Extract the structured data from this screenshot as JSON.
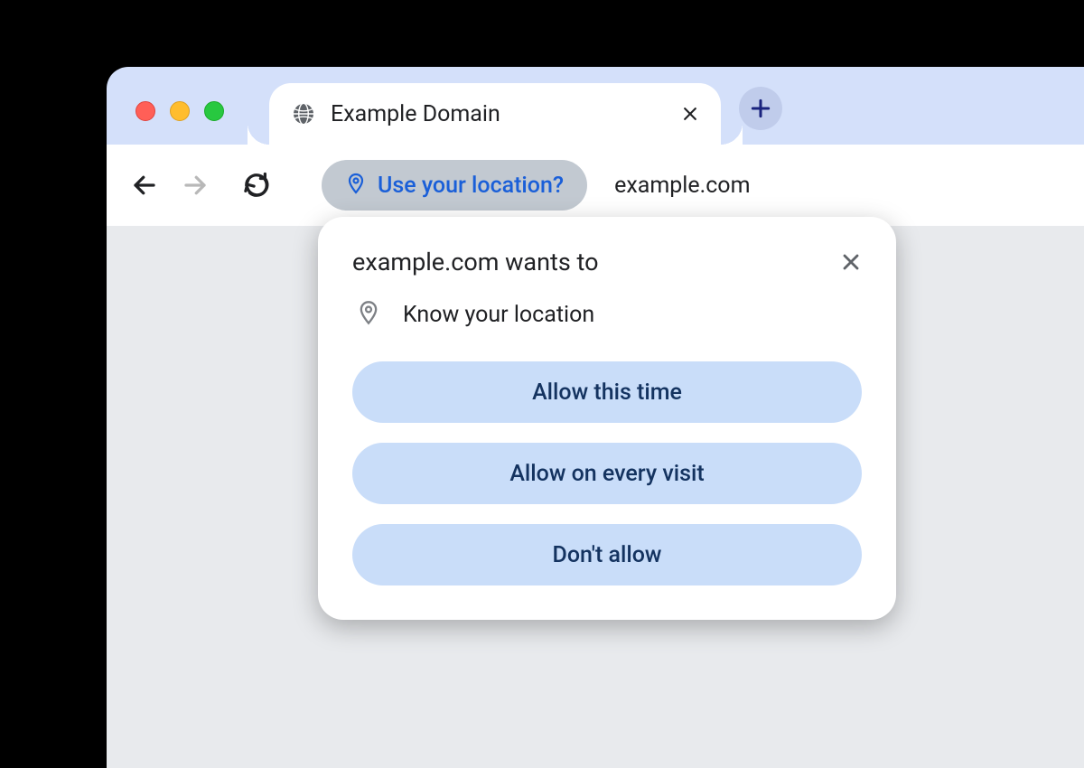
{
  "tab": {
    "title": "Example Domain"
  },
  "address_bar": {
    "chip_text": "Use your location?",
    "url": "example.com"
  },
  "dialog": {
    "title": "example.com wants to",
    "permission_text": "Know your location",
    "buttons": {
      "allow_once": "Allow this time",
      "allow_always": "Allow on every visit",
      "deny": "Don't allow"
    }
  }
}
